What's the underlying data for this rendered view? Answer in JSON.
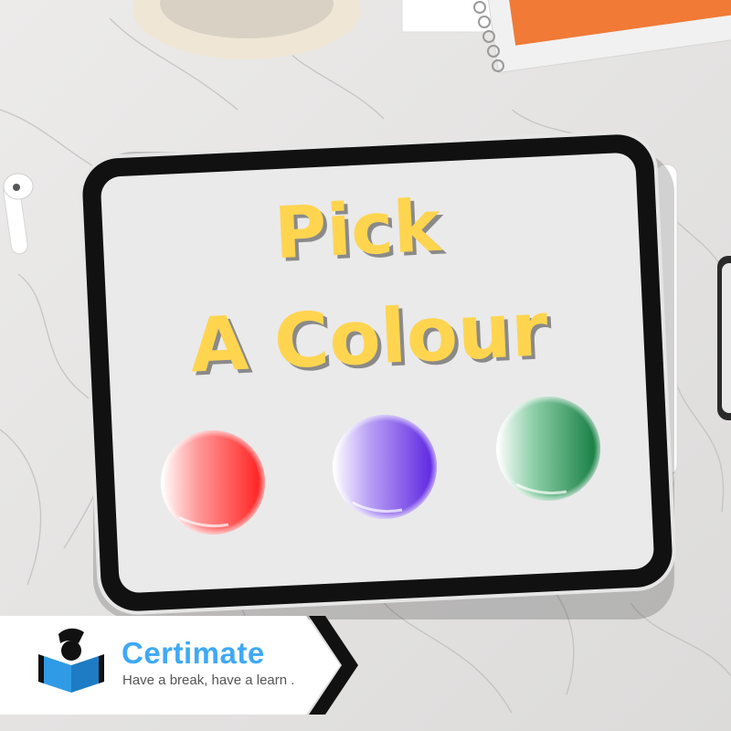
{
  "title": {
    "line1": "Pick",
    "line2": "A Colour"
  },
  "colors": {
    "title": "#FFD54F",
    "brand_name": "#3fa9f5",
    "brand_tag": "#555555",
    "option_red": "#ff2a2a",
    "option_purple": "#6a2ee8",
    "option_green": "#1e8a4a"
  },
  "options": [
    {
      "name": "red",
      "icon": "red-paint-blob"
    },
    {
      "name": "purple",
      "icon": "purple-paint-blob"
    },
    {
      "name": "green",
      "icon": "green-paint-blob"
    }
  ],
  "brand": {
    "name": "Certimate",
    "tagline": "Have a break, have a learn .",
    "logo_icon": "reader-book-icon",
    "arrow_icon": "chevron-right-icon"
  }
}
